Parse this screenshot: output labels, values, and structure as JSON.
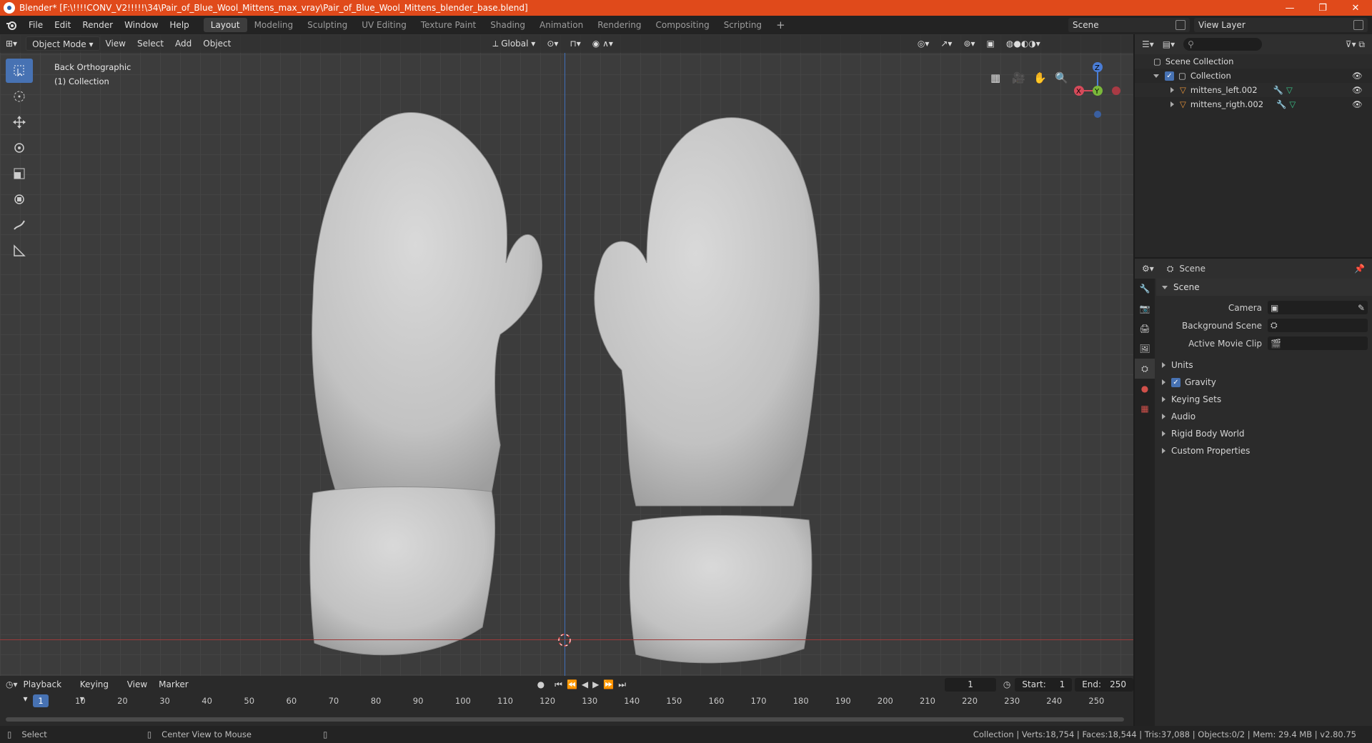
{
  "window": {
    "title": "Blender* [F:\\!!!!CONV_V2!!!!!\\34\\Pair_of_Blue_Wool_Mittens_max_vray\\Pair_of_Blue_Wool_Mittens_blender_base.blend]",
    "minimize": "—",
    "maximize": "❐",
    "close": "✕"
  },
  "menu": [
    "File",
    "Edit",
    "Render",
    "Window",
    "Help"
  ],
  "workspaces": [
    "Layout",
    "Modeling",
    "Sculpting",
    "UV Editing",
    "Texture Paint",
    "Shading",
    "Animation",
    "Rendering",
    "Compositing",
    "Scripting"
  ],
  "workspace_add": "+",
  "scene": "Scene",
  "view_layer": "View Layer",
  "viewport": {
    "mode": "Object Mode",
    "menus": [
      "View",
      "Select",
      "Add",
      "Object"
    ],
    "orientation": "Global",
    "view_name": "Back Orthographic",
    "collection_label": "(1) Collection"
  },
  "gizmo": {
    "z": "Z",
    "x": "X",
    "y": "Y"
  },
  "outliner": {
    "root": "Scene Collection",
    "collection": "Collection",
    "objects": [
      "mittens_left.002",
      "mittens_rigth.002"
    ]
  },
  "properties": {
    "context": "Scene",
    "panel": "Scene",
    "fields": [
      {
        "label": "Camera",
        "value": ""
      },
      {
        "label": "Background Scene",
        "value": ""
      },
      {
        "label": "Active Movie Clip",
        "value": ""
      }
    ],
    "subpanels": [
      "Units",
      "Gravity",
      "Keying Sets",
      "Audio",
      "Rigid Body World",
      "Custom Properties"
    ],
    "gravity_checked": true
  },
  "timeline": {
    "menus": [
      "Playback",
      "Keying",
      "View",
      "Marker"
    ],
    "current_frame": "1",
    "start_label": "Start:",
    "start": "1",
    "end_label": "End:",
    "end": "250",
    "ticks": [
      "10",
      "20",
      "30",
      "40",
      "50",
      "60",
      "70",
      "80",
      "90",
      "100",
      "110",
      "120",
      "130",
      "140",
      "150",
      "160",
      "170",
      "180",
      "190",
      "200",
      "210",
      "220",
      "230",
      "240",
      "250"
    ]
  },
  "statusbar": {
    "left": "Select",
    "middle": "Center View to Mouse",
    "right": "Collection | Verts:18,754 | Faces:18,544 | Tris:37,088 | Objects:0/2 | Mem: 29.4 MB | v2.80.75"
  },
  "colors": {
    "titlebar": "#e04a1b",
    "accent": "#4772b3",
    "viewport": "#3c3c3c"
  }
}
